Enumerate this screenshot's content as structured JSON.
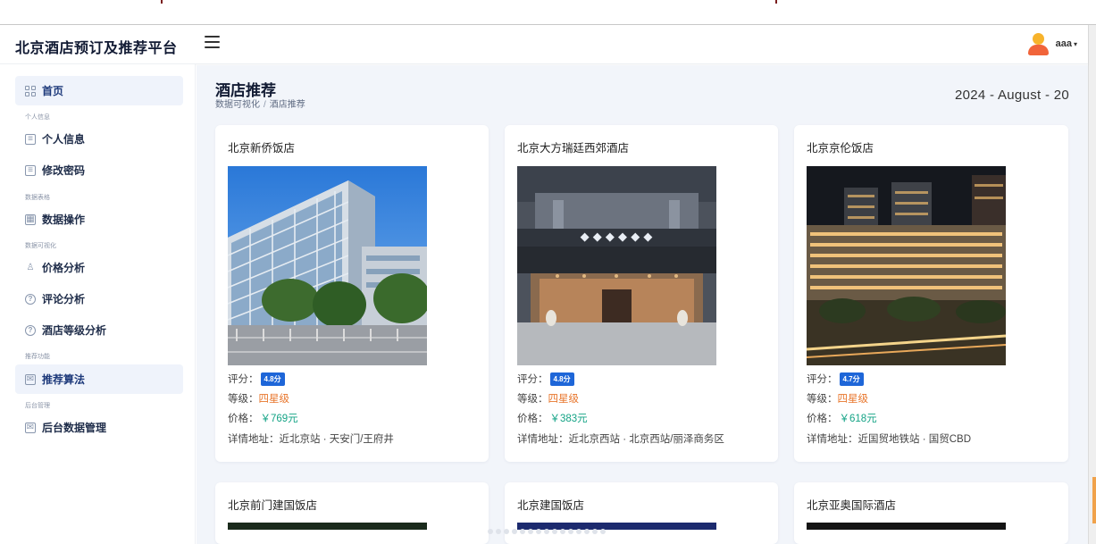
{
  "app": {
    "title": "北京酒店预订及推荐平台"
  },
  "header": {
    "username": "aaa",
    "caret": "▾"
  },
  "sidebar": {
    "items": [
      {
        "label": "首页",
        "icon": "dashboard-icon"
      },
      {
        "label": "个人信息",
        "icon": "id-card-icon"
      },
      {
        "label": "修改密码",
        "icon": "document-icon"
      },
      {
        "label": "数据操作",
        "icon": "table-icon"
      },
      {
        "label": "价格分析",
        "icon": "user-icon"
      },
      {
        "label": "评论分析",
        "icon": "question-circle-icon"
      },
      {
        "label": "酒店等级分析",
        "icon": "question-circle-icon"
      },
      {
        "label": "推荐算法",
        "icon": "mail-icon"
      },
      {
        "label": "后台数据管理",
        "icon": "mail-icon"
      }
    ],
    "sections": [
      {
        "label": "个人信息"
      },
      {
        "label": "数据表格"
      },
      {
        "label": "数据可视化"
      },
      {
        "label": "推荐功能"
      },
      {
        "label": "后台管理"
      }
    ]
  },
  "main": {
    "title": "酒店推荐",
    "breadcrumb": {
      "parent": "数据可视化",
      "separator": "/",
      "current": "酒店推荐"
    },
    "date": "2024 - August - 20",
    "labels": {
      "rating": "评分：",
      "grade": "等级：",
      "price": "价格：",
      "address": "详情地址："
    },
    "hotels": [
      {
        "name": "北京新侨饭店",
        "rating": "4.8分",
        "grade": "四星级",
        "price": "￥769元",
        "address": "近北京站 · 天安门/王府井"
      },
      {
        "name": "北京大方瑞廷西郊酒店",
        "rating": "4.8分",
        "grade": "四星级",
        "price": "￥383元",
        "address": "近北京西站 · 北京西站/丽泽商务区"
      },
      {
        "name": "北京京伦饭店",
        "rating": "4.7分",
        "grade": "四星级",
        "price": "￥618元",
        "address": "近国贸地铁站 · 国贸CBD"
      },
      {
        "name": "北京前门建国饭店"
      },
      {
        "name": "北京建国饭店"
      },
      {
        "name": "北京亚奥国际酒店"
      }
    ]
  },
  "colors": {
    "rating_badge": "#1e66d8",
    "grade": "#e8762c",
    "price": "#13a385",
    "active_nav_bg": "#eff3fb"
  }
}
